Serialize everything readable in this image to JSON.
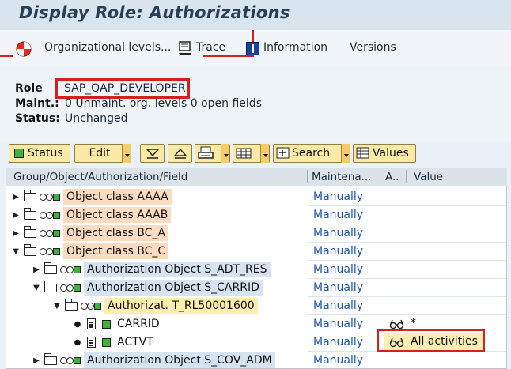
{
  "title": "Display Role: Authorizations",
  "app_toolbar": {
    "org_levels": "Organizational levels...",
    "trace": "Trace",
    "information": "Information",
    "versions": "Versions"
  },
  "header": {
    "role_label": "Role",
    "role_value": "SAP_QAP_DEVELOPER",
    "maint_label": "Maint.:",
    "maint_value": "0 Unmaint. org. levels 0 open fields",
    "status_label": "Status:",
    "status_value": "Unchanged"
  },
  "toolbar": {
    "status": "Status",
    "edit": "Edit",
    "search": "Search",
    "values": "Values"
  },
  "columns": {
    "group": "Group/Object/Authorization/Field",
    "maintenance": "Maintena...",
    "a": "A..",
    "value": "Value"
  },
  "rows": [
    {
      "text": "Object class AAAA",
      "maint": "Manually",
      "value": ""
    },
    {
      "text": "Object class AAAB",
      "maint": "Manually",
      "value": ""
    },
    {
      "text": "Object class BC_A",
      "maint": "Manually",
      "value": ""
    },
    {
      "text": "Object class BC_C",
      "maint": "Manually",
      "value": ""
    },
    {
      "text": "Authorization Object S_ADT_RES",
      "maint": "Manually",
      "value": ""
    },
    {
      "text": "Authorization Object S_CARRID",
      "maint": "Manually",
      "value": ""
    },
    {
      "text": "Authorizat. T_RL50001600",
      "maint": "Manually",
      "value": ""
    },
    {
      "text": "CARRID",
      "maint": "Manually",
      "value": "*"
    },
    {
      "text": "ACTVT",
      "maint": "Manually",
      "value": "All activities"
    },
    {
      "text": "Authorization Object S_COV_ADM",
      "maint": "Manually",
      "value": ""
    }
  ],
  "colors": {
    "class_bg": "#fcdcc0",
    "object_bg": "#d6e4f2",
    "auth_bg": "#fbeeb0",
    "maint_text": "#1f56a8",
    "highlight_red": "#d42020"
  }
}
